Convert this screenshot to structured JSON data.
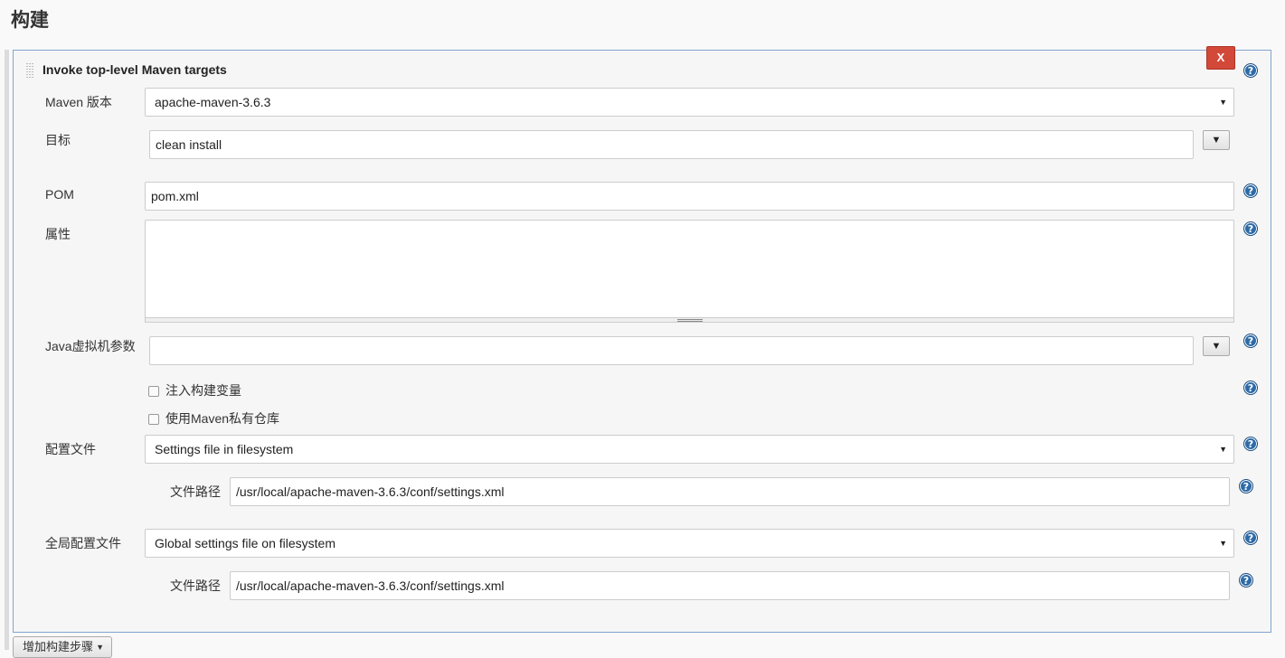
{
  "section": {
    "title": "构建"
  },
  "step": {
    "title": "Invoke top-level Maven targets",
    "delete_label": "X",
    "maven_version": {
      "label": "Maven 版本",
      "value": "apache-maven-3.6.3"
    },
    "goals": {
      "label": "目标",
      "value": "clean install"
    },
    "pom": {
      "label": "POM",
      "value": "pom.xml"
    },
    "properties": {
      "label": "属性",
      "value": ""
    },
    "jvm_options": {
      "label": "Java虚拟机参数",
      "value": ""
    },
    "inject_build_vars": {
      "label": "注入构建变量",
      "checked": false
    },
    "private_repo": {
      "label": "使用Maven私有仓库",
      "checked": false
    },
    "settings": {
      "label": "配置文件",
      "value": "Settings file in filesystem",
      "path_label": "文件路径",
      "path_value": "/usr/local/apache-maven-3.6.3/conf/settings.xml"
    },
    "global_settings": {
      "label": "全局配置文件",
      "value": "Global settings file on filesystem",
      "path_label": "文件路径",
      "path_value": "/usr/local/apache-maven-3.6.3/conf/settings.xml"
    }
  },
  "icons": {
    "help": "?",
    "caret": "▼"
  },
  "footer": {
    "add_step_label": "增加构建步骤"
  },
  "colors": {
    "accent": "#2d6ba8",
    "danger": "#d24939",
    "panel_border": "#7fa5cf"
  }
}
